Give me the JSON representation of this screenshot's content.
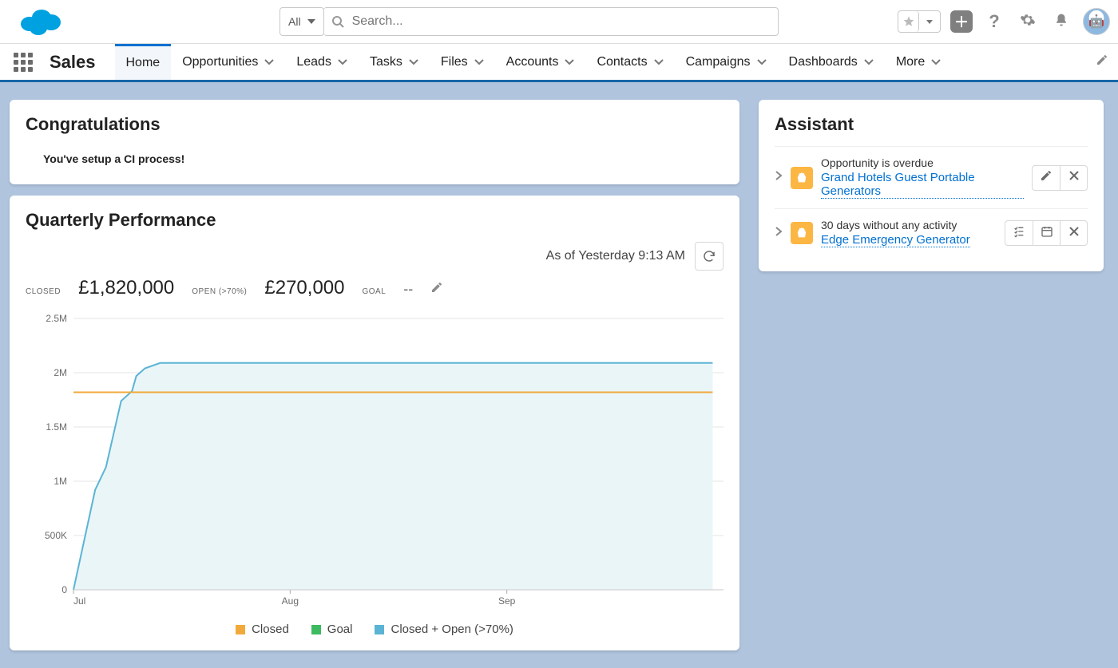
{
  "header": {
    "search_scope": "All",
    "search_placeholder": "Search..."
  },
  "nav": {
    "app_name": "Sales",
    "tabs": [
      {
        "label": "Home",
        "active": true,
        "has_menu": false
      },
      {
        "label": "Opportunities",
        "active": false,
        "has_menu": true
      },
      {
        "label": "Leads",
        "active": false,
        "has_menu": true
      },
      {
        "label": "Tasks",
        "active": false,
        "has_menu": true
      },
      {
        "label": "Files",
        "active": false,
        "has_menu": true
      },
      {
        "label": "Accounts",
        "active": false,
        "has_menu": true
      },
      {
        "label": "Contacts",
        "active": false,
        "has_menu": true
      },
      {
        "label": "Campaigns",
        "active": false,
        "has_menu": true
      },
      {
        "label": "Dashboards",
        "active": false,
        "has_menu": true
      },
      {
        "label": "More",
        "active": false,
        "has_menu": true
      }
    ]
  },
  "congrats": {
    "title": "Congratulations",
    "message": "You've setup a CI process!"
  },
  "quarterly": {
    "title": "Quarterly Performance",
    "as_of": "As of Yesterday 9:13 AM",
    "closed_label": "CLOSED",
    "closed_value": "£1,820,000",
    "open_label": "OPEN (>70%)",
    "open_value": "£270,000",
    "goal_label": "GOAL",
    "goal_value": "--"
  },
  "assistant": {
    "title": "Assistant",
    "items": [
      {
        "reason": "Opportunity is overdue",
        "link": "Grand Hotels Guest Portable Generators",
        "actions": [
          "edit",
          "dismiss"
        ]
      },
      {
        "reason": "30 days without any activity",
        "link": "Edge Emergency Generator",
        "actions": [
          "task",
          "event",
          "dismiss"
        ]
      }
    ]
  },
  "legend": {
    "closed": "Closed",
    "goal": "Goal",
    "open": "Closed + Open (>70%)"
  },
  "colors": {
    "closed": "#f2a93b",
    "goal": "#3cbb60",
    "open": "#5bb4d3",
    "open_fill": "#eaf5f8"
  },
  "chart_data": {
    "type": "line",
    "title": "Quarterly Performance",
    "xlabel": "",
    "ylabel": "",
    "x": [
      "Jul",
      "Aug",
      "Sep"
    ],
    "y_ticks": [
      0,
      500000,
      1000000,
      1500000,
      2000000,
      2500000
    ],
    "y_tick_labels": [
      "0",
      "500K",
      "1M",
      "1.5M",
      "2M",
      "2.5M"
    ],
    "ylim": [
      0,
      2500000
    ],
    "series": [
      {
        "name": "Closed + Open (>70%)",
        "color": "#5bb4d3",
        "fill": "#eaf5f8",
        "points": [
          {
            "t": 0.0,
            "v": 0
          },
          {
            "t": 0.1,
            "v": 920000
          },
          {
            "t": 0.15,
            "v": 1130000
          },
          {
            "t": 0.22,
            "v": 1740000
          },
          {
            "t": 0.27,
            "v": 1830000
          },
          {
            "t": 0.29,
            "v": 1970000
          },
          {
            "t": 0.33,
            "v": 2040000
          },
          {
            "t": 0.4,
            "v": 2090000
          },
          {
            "t": 2.95,
            "v": 2090000
          }
        ]
      },
      {
        "name": "Closed",
        "color": "#f2a93b",
        "points": [
          {
            "t": 0.0,
            "v": 1820000
          },
          {
            "t": 2.95,
            "v": 1820000
          }
        ]
      }
    ],
    "legend": [
      "Closed",
      "Goal",
      "Closed + Open (>70%)"
    ]
  }
}
